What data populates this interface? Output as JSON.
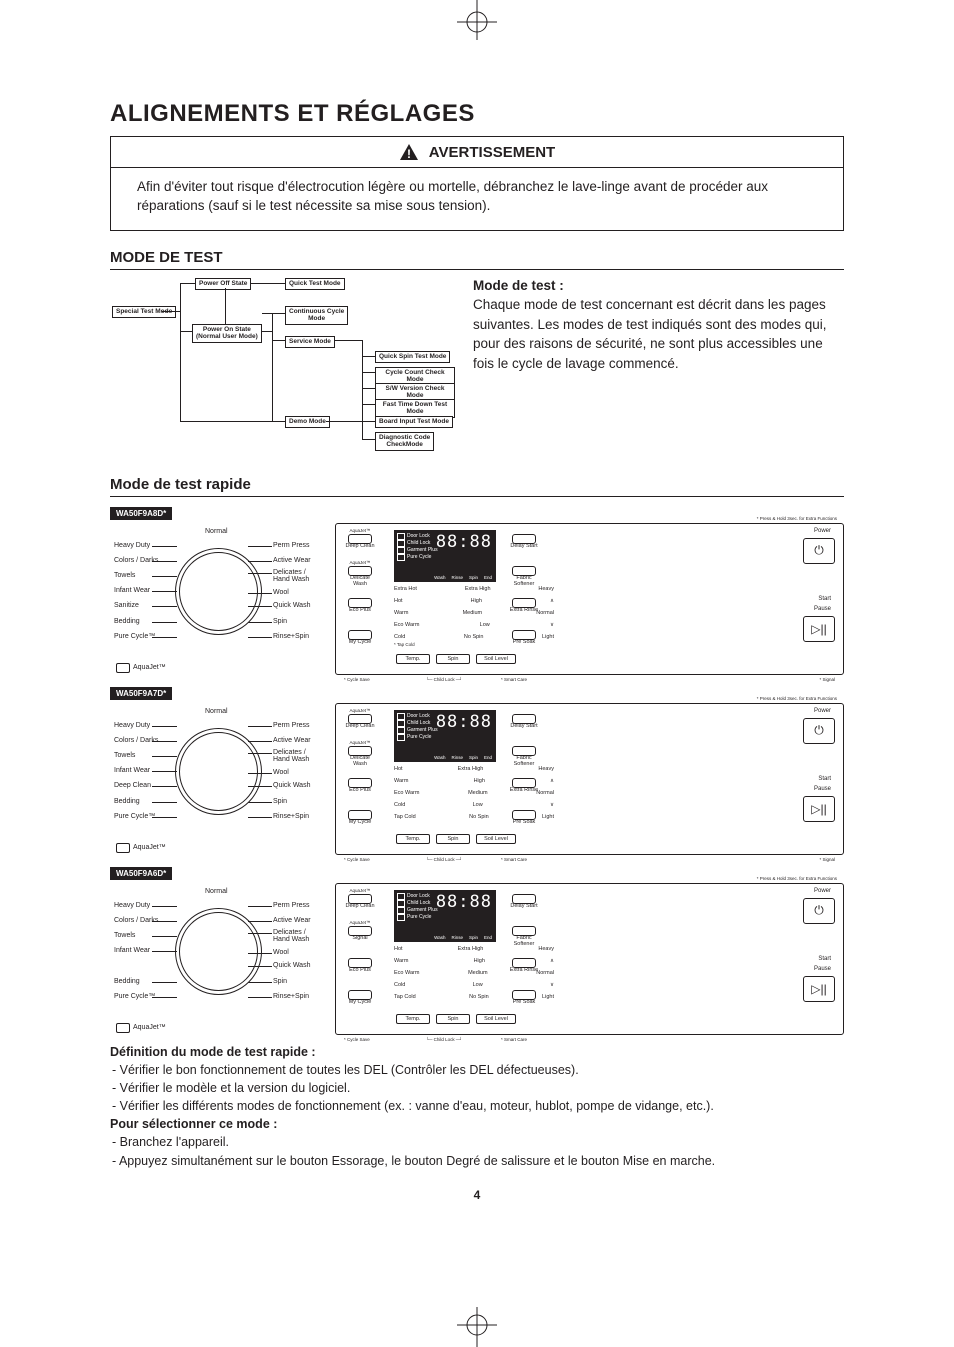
{
  "title": "ALIGNEMENTS ET RÉGLAGES",
  "warning": {
    "label": "AVERTISSEMENT",
    "body": "Afin d'éviter tout risque d'électrocution légère ou mortelle, débranchez le lave-linge avant de procéder aux réparations (sauf si le test nécessite sa mise sous tension)."
  },
  "section1": {
    "heading": "MODE DE TEST",
    "desc_title": "Mode de test :",
    "desc_body": "Chaque mode de test concernant est décrit dans les pages suivantes.  Les modes de test indiqués sont des modes qui, pour des raisons de sécurité, ne sont plus accessibles une fois le cycle de lavage commencé."
  },
  "flow": {
    "power_off": "Power Off State",
    "quick_test": "Quick Test Mode",
    "special": "Special Test Mode",
    "power_on": "Power On State\n(Normal User Mode)",
    "cont_cycle": "Continuous Cycle\nMode",
    "service": "Service Mode",
    "demo": "Demo Mode",
    "spin_test": "Quick Spin Test Mode",
    "cycle_count": "Cycle Count Check Mode",
    "sw_version": "S/W Version Check Mode",
    "fast_down": "Fast Time Down Test Mode",
    "board_input": "Board Input Test Mode",
    "diag_code": "Diagnostic Code\nCheckMode"
  },
  "section2": "Mode de test rapide",
  "models": [
    "WA50F9A8D*",
    "WA50F9A7D*",
    "WA50F9A6D*"
  ],
  "dial": {
    "normal": "Normal",
    "heavy": "Heavy Duty",
    "colors": "Colors / Darks",
    "towels": "Towels",
    "infant": "Infant Wear",
    "sanitize": "Sanitize",
    "deep": "Deep Clean",
    "bedding": "Bedding",
    "pure": "Pure Cycle™",
    "perm": "Perm Press",
    "active": "Active Wear",
    "delicates": "Delicates /\nHand Wash",
    "wool": "Wool",
    "quick": "Quick Wash",
    "spin": "Spin",
    "rinse": "Rinse+Spin",
    "aquajet": "AquaJet™"
  },
  "panel": {
    "press_hold": "* Press & Hold 3sec. for Extra Functions",
    "deep_clean": "Deep Clean",
    "aquajet_sm": "AquaJet™",
    "delicate_wash": "Delicate\nWash",
    "signal": "Signal",
    "eco_plus": "Eco Plus",
    "my_cycle": "My Cycle",
    "door_lock": "Door Lock",
    "child_lock": "Child Lock",
    "garment": "Garment Plus",
    "pure_cycle": "Pure Cycle",
    "seg": "88:88",
    "wash": "Wash",
    "rinse": "Rinse",
    "spin_d": "Spin",
    "end": "End",
    "delay": "Delay Start",
    "fabric": "Fabric\nSoftener",
    "extra_rinse": "Extra Rinse",
    "pre_soak": "Pre Soak",
    "power": "Power",
    "start": "Start",
    "pause": "Pause",
    "temp": "Temp.",
    "spin_b": "Spin",
    "soil": "Soil Level",
    "r1": {
      "a": "Extra Hot",
      "b": "Extra High",
      "c": "Heavy"
    },
    "r2": {
      "a": "Hot",
      "b": "High",
      "c": "∧"
    },
    "r3": {
      "a": "Warm",
      "b": "Medium",
      "c": "Normal"
    },
    "r4": {
      "a": "Eco Warm",
      "b": "Low",
      "c": "∨"
    },
    "r5": {
      "a": "Cold",
      "b": "No Spin",
      "c": "Light"
    },
    "r5tap": "* Tap Cold",
    "alt_r1": {
      "a": "Hot",
      "b": "Extra High",
      "c": "Heavy"
    },
    "alt_r2": {
      "a": "Warm",
      "b": "High",
      "c": "∧"
    },
    "alt_r3": {
      "a": "Eco Warm",
      "b": "Medium",
      "c": "Normal"
    },
    "alt_r4": {
      "a": "Cold",
      "b": "Low",
      "c": "∨"
    },
    "alt_r5": {
      "a": "Tap Cold",
      "b": "No Spin",
      "c": "Light"
    },
    "cycle_save": "* Cycle Save",
    "child_lock_f": "Child Lock",
    "smart_care": "* Smart Care",
    "signal_f": "* Signal"
  },
  "defs": {
    "h1": "Définition du mode de test rapide :",
    "l1": "-   Vérifier le bon fonctionnement de toutes les DEL (Contrôler les DEL défectueuses).",
    "l2": "-   Vérifier le modèle et la version du logiciel.",
    "l3": "-   Vérifier les différents modes de fonctionnement (ex. : vanne d'eau, moteur, hublot, pompe de vidange, etc.).",
    "h2": "Pour sélectionner ce mode :",
    "l4": "-   Branchez l'appareil.",
    "l5": "-   Appuyez simultanément sur le bouton Essorage, le bouton Degré de salissure et le bouton Mise en marche."
  },
  "page_number": "4"
}
